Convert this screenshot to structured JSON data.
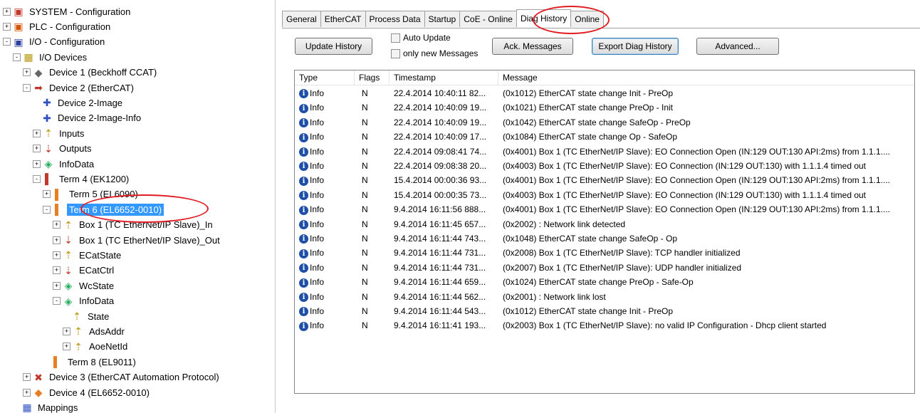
{
  "tree": {
    "items": [
      {
        "label": "SYSTEM - Configuration",
        "expander": "+",
        "icon": "system-config-icon",
        "color": "#c0392b"
      },
      {
        "label": "PLC - Configuration",
        "expander": "+",
        "icon": "plc-config-icon",
        "color": "#d35400"
      },
      {
        "label": "I/O - Configuration",
        "expander": "-",
        "icon": "io-config-icon",
        "color": "#2c3e9e"
      },
      {
        "label": "I/O Devices",
        "expander": "-",
        "icon": "io-devices-icon",
        "color": "#b7950b"
      },
      {
        "label": "Device 1 (Beckhoff CCAT)",
        "expander": "+",
        "icon": "device-icon",
        "color": "#666666"
      },
      {
        "label": "Device 2 (EtherCAT)",
        "expander": "-",
        "icon": "ethercat-device-icon",
        "color": "#c0392b"
      },
      {
        "label": "Device 2-Image",
        "expander": "",
        "icon": "image-icon",
        "color": "#2e4fbf"
      },
      {
        "label": "Device 2-Image-Info",
        "expander": "",
        "icon": "image-info-icon",
        "color": "#2e4fbf"
      },
      {
        "label": "Inputs",
        "expander": "+",
        "icon": "inputs-icon",
        "color": "#b7950b"
      },
      {
        "label": "Outputs",
        "expander": "+",
        "icon": "outputs-icon",
        "color": "#c0392b"
      },
      {
        "label": "InfoData",
        "expander": "+",
        "icon": "infodata-icon",
        "color": "#27ae60"
      },
      {
        "label": "Term 4 (EK1200)",
        "expander": "-",
        "icon": "terminal-icon",
        "color": "#c0392b"
      },
      {
        "label": "Term 5 (EL6090)",
        "expander": "+",
        "icon": "terminal-icon",
        "color": "#e67e22"
      },
      {
        "label": "Term 6 (EL6652-0010)",
        "expander": "-",
        "icon": "terminal-icon",
        "color": "#e67e22",
        "selected": true
      },
      {
        "label": "Box 1 (TC EtherNet/IP Slave)_In",
        "expander": "+",
        "icon": "inputs-icon",
        "color": "#b7950b"
      },
      {
        "label": "Box 1 (TC EtherNet/IP Slave)_Out",
        "expander": "+",
        "icon": "outputs-icon",
        "color": "#c0392b"
      },
      {
        "label": "ECatState",
        "expander": "+",
        "icon": "inputs-icon",
        "color": "#b7950b"
      },
      {
        "label": "ECatCtrl",
        "expander": "+",
        "icon": "outputs-icon",
        "color": "#c0392b"
      },
      {
        "label": "WcState",
        "expander": "+",
        "icon": "infodata-icon",
        "color": "#27ae60"
      },
      {
        "label": "InfoData",
        "expander": "-",
        "icon": "infodata-icon",
        "color": "#27ae60"
      },
      {
        "label": "State",
        "expander": "",
        "icon": "variable-icon",
        "color": "#b7950b"
      },
      {
        "label": "AdsAddr",
        "expander": "+",
        "icon": "variable-icon",
        "color": "#b7950b"
      },
      {
        "label": "AoeNetId",
        "expander": "+",
        "icon": "variable-icon",
        "color": "#b7950b"
      },
      {
        "label": "Term 8 (EL9011)",
        "expander": "",
        "icon": "end-terminal-icon",
        "color": "#e67e22"
      },
      {
        "label": "Device 3 (EtherCAT Automation Protocol)",
        "expander": "+",
        "icon": "eap-device-icon",
        "color": "#c0392b"
      },
      {
        "label": "Device 4 (EL6652-0010)",
        "expander": "+",
        "icon": "device-icon",
        "color": "#e67e22"
      },
      {
        "label": "Mappings",
        "expander": "",
        "icon": "mappings-icon",
        "color": "#2e4fbf"
      }
    ]
  },
  "tabs": [
    "General",
    "EtherCAT",
    "Process Data",
    "Startup",
    "CoE - Online",
    "Diag History",
    "Online"
  ],
  "active_tab": "Diag History",
  "toolbar": {
    "update_history": "Update History",
    "auto_update": "Auto Update",
    "only_new": "only new Messages",
    "ack_messages": "Ack. Messages",
    "export": "Export Diag History",
    "advanced": "Advanced..."
  },
  "list": {
    "columns": [
      "Type",
      "Flags",
      "Timestamp",
      "Message"
    ],
    "rows": [
      {
        "type": "Info",
        "flags": "N",
        "timestamp": "22.4.2014 10:40:11 82...",
        "message": "(0x1012) EtherCAT state change Init - PreOp"
      },
      {
        "type": "Info",
        "flags": "N",
        "timestamp": "22.4.2014 10:40:09 19...",
        "message": "(0x1021) EtherCAT state change PreOp - Init"
      },
      {
        "type": "Info",
        "flags": "N",
        "timestamp": "22.4.2014 10:40:09 19...",
        "message": "(0x1042) EtherCAT state change SafeOp - PreOp"
      },
      {
        "type": "Info",
        "flags": "N",
        "timestamp": "22.4.2014 10:40:09 17...",
        "message": "(0x1084) EtherCAT state change Op - SafeOp"
      },
      {
        "type": "Info",
        "flags": "N",
        "timestamp": "22.4.2014 09:08:41 74...",
        "message": "(0x4001) Box 1 (TC EtherNet/IP Slave): EO Connection Open (IN:129 OUT:130 API:2ms) from 1.1.1...."
      },
      {
        "type": "Info",
        "flags": "N",
        "timestamp": "22.4.2014 09:08:38 20...",
        "message": "(0x4003) Box 1 (TC EtherNet/IP Slave): EO Connection (IN:129 OUT:130) with 1.1.1.4 timed out"
      },
      {
        "type": "Info",
        "flags": "N",
        "timestamp": "15.4.2014 00:00:36 93...",
        "message": "(0x4001) Box 1 (TC EtherNet/IP Slave): EO Connection Open (IN:129 OUT:130 API:2ms) from 1.1.1...."
      },
      {
        "type": "Info",
        "flags": "N",
        "timestamp": "15.4.2014 00:00:35 73...",
        "message": "(0x4003) Box 1 (TC EtherNet/IP Slave): EO Connection (IN:129 OUT:130) with 1.1.1.4 timed out"
      },
      {
        "type": "Info",
        "flags": "N",
        "timestamp": "9.4.2014 16:11:56 888...",
        "message": "(0x4001) Box 1 (TC EtherNet/IP Slave): EO Connection Open (IN:129 OUT:130 API:2ms) from 1.1.1...."
      },
      {
        "type": "Info",
        "flags": "N",
        "timestamp": "9.4.2014 16:11:45 657...",
        "message": "(0x2002) : Network link detected"
      },
      {
        "type": "Info",
        "flags": "N",
        "timestamp": "9.4.2014 16:11:44 743...",
        "message": "(0x1048) EtherCAT state change SafeOp - Op"
      },
      {
        "type": "Info",
        "flags": "N",
        "timestamp": "9.4.2014 16:11:44 731...",
        "message": "(0x2008) Box 1 (TC EtherNet/IP Slave): TCP handler initialized"
      },
      {
        "type": "Info",
        "flags": "N",
        "timestamp": "9.4.2014 16:11:44 731...",
        "message": "(0x2007) Box 1 (TC EtherNet/IP Slave): UDP handler initialized"
      },
      {
        "type": "Info",
        "flags": "N",
        "timestamp": "9.4.2014 16:11:44 659...",
        "message": "(0x1024) EtherCAT state change PreOp - Safe-Op"
      },
      {
        "type": "Info",
        "flags": "N",
        "timestamp": "9.4.2014 16:11:44 562...",
        "message": "(0x2001) : Network link lost"
      },
      {
        "type": "Info",
        "flags": "N",
        "timestamp": "9.4.2014 16:11:44 543...",
        "message": "(0x1012) EtherCAT state change Init - PreOp"
      },
      {
        "type": "Info",
        "flags": "N",
        "timestamp": "9.4.2014 16:11:41 193...",
        "message": "(0x2003) Box 1 (TC EtherNet/IP Slave): no valid IP Configuration - Dhcp client started"
      }
    ]
  }
}
